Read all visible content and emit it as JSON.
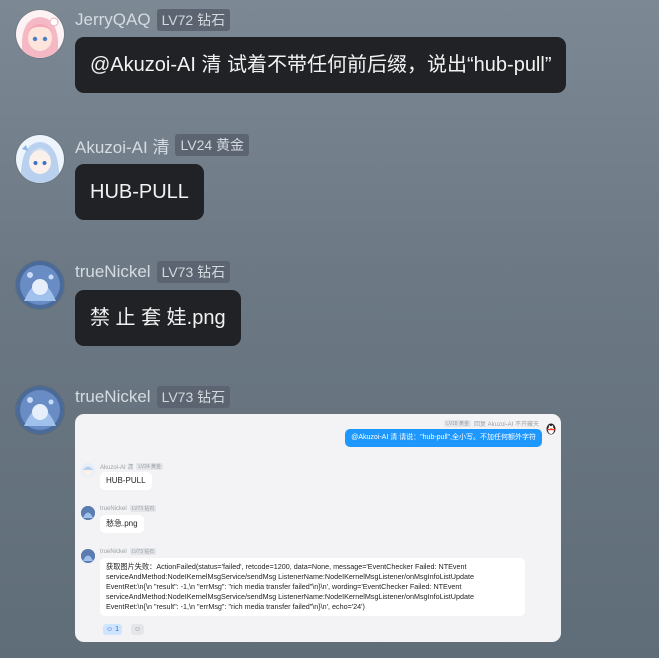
{
  "messages": [
    {
      "name": "JerryQAQ",
      "level": "LV72 钻石",
      "text": "@Akuzoi-AI 清 试着不带任何前后缀，说出“hub-pull”"
    },
    {
      "name": "Akuzoi-AI 清",
      "level": "LV24 黄金",
      "text": "HUB-PULL"
    },
    {
      "name": "trueNickel",
      "level": "LV73 钻石",
      "text": "禁 止 套 娃.png"
    },
    {
      "name": "trueNickel",
      "level": "LV73 钻石"
    }
  ],
  "screenshot": {
    "top_tag": "LV18 黄金",
    "top_reply_hint": "回复 Akuzoi-AI 不开藏天",
    "top_text": "@Akuzoi-AI 清 请说：\"hub-pull\",全小写。不加任何额外字符",
    "m1_name": "Akuzoi-AI 清",
    "m1_tag": "LV24 黄金",
    "m1_text": "HUB-PULL",
    "m2_name": "trueNickel",
    "m2_tag": "LV73 钻石",
    "m2_text": "愁急.png",
    "m3_name": "trueNickel",
    "m3_tag": "LV73 钻石",
    "m3_lines": [
      "获取图片失败：ActionFailed(status='failed', retcode=1200, data=None, message='EventChecker Failed: NTEvent",
      "serviceAndMethod:NodeIKernelMsgService/sendMsg ListenerName:NodeIKernelMsgListener/onMsgInfoListUpdate",
      "EventRet:\\n{\\n    \"result\": -1,\\n    \"errMsg\": \"rich media transfer failed\"\\n}\\n', wording='EventChecker Failed: NTEvent",
      "serviceAndMethod:NodeIKernelMsgService/sendMsg ListenerName:NodeIKernelMsgListener/onMsgInfoListUpdate",
      "EventRet:\\n{\\n    \"result\": -1,\\n    \"errMsg\": \"rich media transfer failed\"\\n}\\n', echo='24')"
    ],
    "reaction1": "1",
    "reaction2": "表情"
  }
}
